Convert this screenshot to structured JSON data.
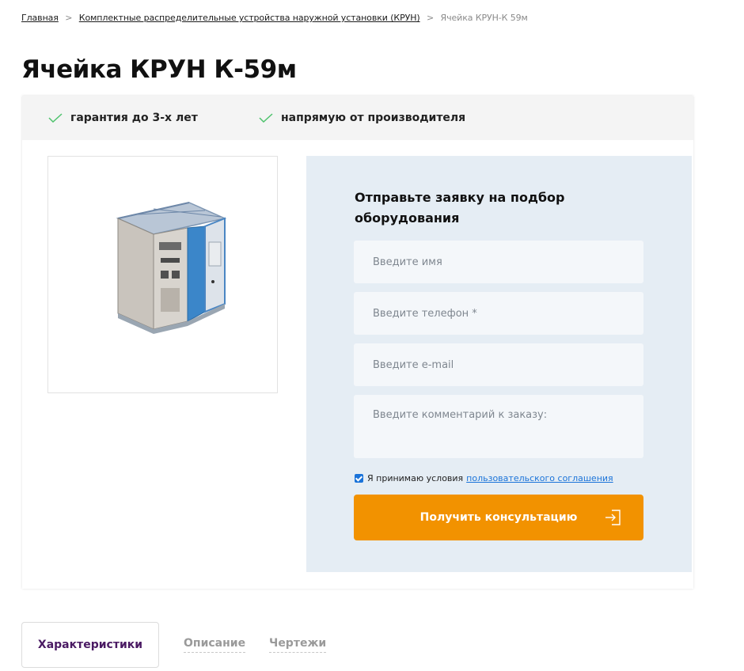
{
  "breadcrumb": {
    "home": "Главная",
    "category": "Комплектные распределительные устройства наружной установки (КРУН)",
    "separator": ">",
    "current": "Ячейка КРУН-К 59м"
  },
  "page": {
    "title": "Ячейка КРУН К-59м"
  },
  "benefits": [
    {
      "label": "гарантия до 3-х лет",
      "icon": "check-icon"
    },
    {
      "label": "напрямую от производителя",
      "icon": "check-icon"
    }
  ],
  "colors": {
    "accent_button": "#f29200",
    "form_background": "#e5edf4",
    "check_green": "#4ec36d",
    "link_blue": "#1a73d9",
    "active_tab_text": "#4a1a63"
  },
  "form": {
    "title": "Отправьте заявку на подбор оборудования",
    "name_placeholder": "Введите имя",
    "phone_placeholder": "Введите телефон *",
    "email_placeholder": "Введите e-mail",
    "comment_placeholder": "Введите комментарий к заказу:",
    "agree_text": "Я принимаю условия",
    "agree_link": "пользовательского соглашения",
    "agree_checked": true,
    "submit_label": "Получить консультацию",
    "submit_icon": "sign-in-icon"
  },
  "tabs": [
    {
      "label": "Характеристики",
      "active": true
    },
    {
      "label": "Описание",
      "active": false
    },
    {
      "label": "Чертежи",
      "active": false
    }
  ]
}
